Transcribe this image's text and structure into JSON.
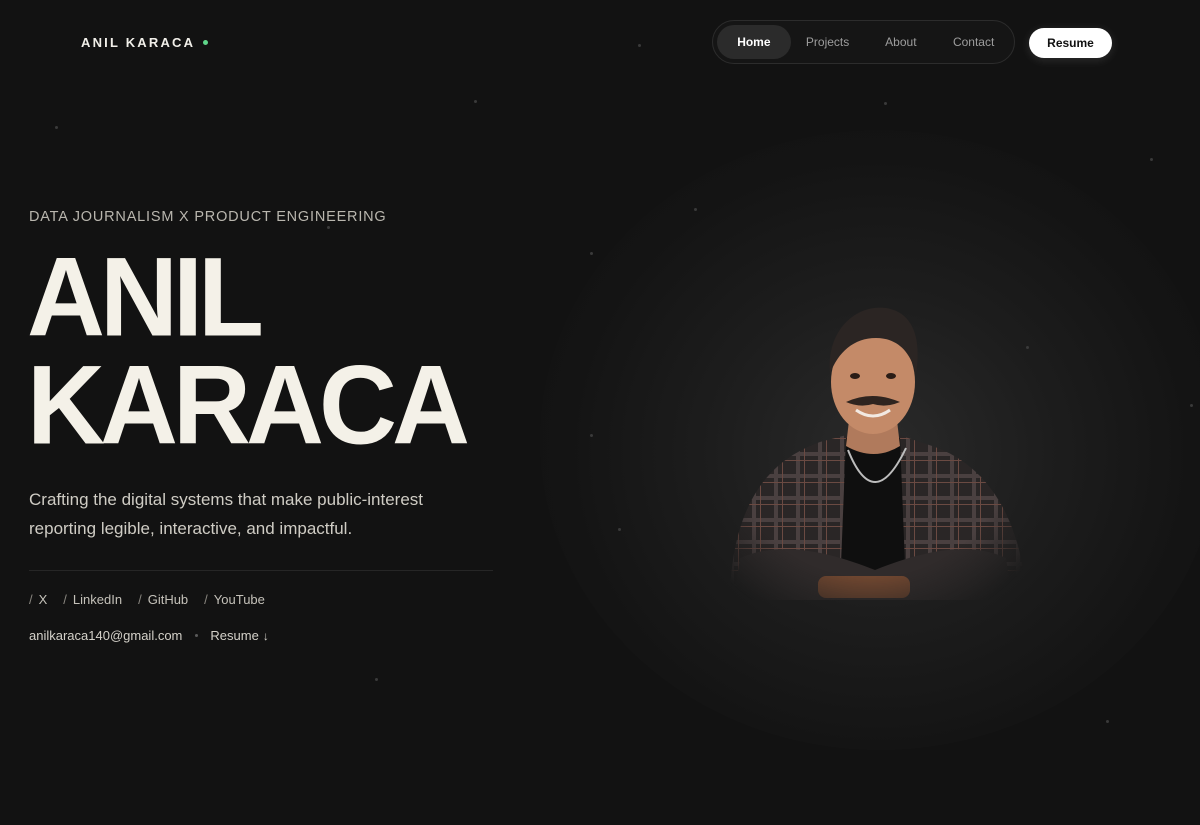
{
  "brand": {
    "name": "ANIL KARACA"
  },
  "nav": {
    "items": [
      {
        "label": "Home",
        "active": true
      },
      {
        "label": "Projects",
        "active": false
      },
      {
        "label": "About",
        "active": false
      },
      {
        "label": "Contact",
        "active": false
      }
    ],
    "resume_button": "Resume"
  },
  "hero": {
    "eyebrow": "DATA JOURNALISM X PRODUCT ENGINEERING",
    "name_line1": "ANIL",
    "name_line2": "KARACA",
    "tagline": "Crafting the digital systems that make public-interest reporting legible, interactive, and impactful."
  },
  "socials": [
    {
      "label": "X"
    },
    {
      "label": "LinkedIn"
    },
    {
      "label": "GitHub"
    },
    {
      "label": "YouTube"
    }
  ],
  "contact": {
    "email": "anilkaraca140@gmail.com",
    "resume_link": "Resume",
    "resume_icon": "↓"
  },
  "colors": {
    "background": "#121212",
    "status_dot": "#5fd68a",
    "headline": "#f4f1e8"
  }
}
